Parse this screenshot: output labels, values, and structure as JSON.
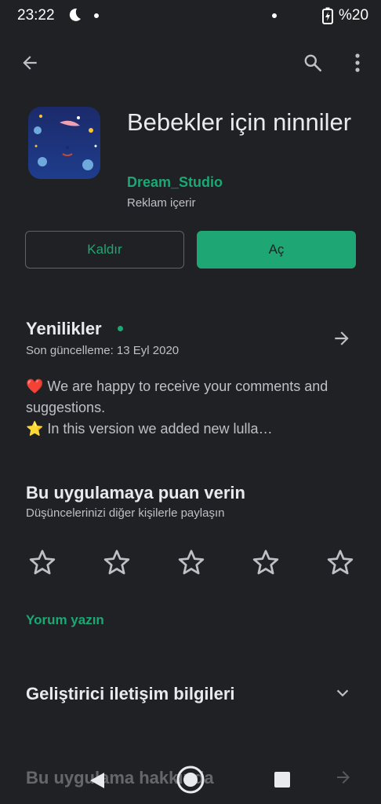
{
  "status_bar": {
    "time": "23:22",
    "battery": "%20"
  },
  "top_bar": {
    "back_icon": "arrow-left-icon",
    "search_icon": "search-icon",
    "more_icon": "more-vert-icon"
  },
  "app": {
    "title": "Bebekler için ninniler",
    "developer": "Dream_Studio",
    "ads_note": "Reklam içerir",
    "uninstall_label": "Kaldır",
    "open_label": "Aç"
  },
  "whats_new": {
    "title": "Yenilikler",
    "last_update": "Son güncelleme: 13 Eyl 2020",
    "line1": "❤️ We are happy to receive your comments and suggestions.",
    "line2": "⭐ In this version we added new lulla…"
  },
  "rate": {
    "title": "Bu uygulamaya puan verin",
    "subtitle": "Düşüncelerinizi diğer kişilerle paylaşın",
    "stars": 5,
    "selected": 0,
    "write_review": "Yorum yazın"
  },
  "dev_contact": {
    "title": "Geliştirici iletişim bilgileri"
  },
  "about": {
    "title": "Bu uygulama hakkında"
  },
  "colors": {
    "background": "#202124",
    "accent": "#1aa874",
    "text": "#e8eaed"
  }
}
